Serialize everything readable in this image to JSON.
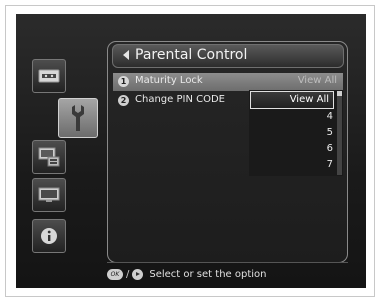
{
  "header": {
    "title": "Parental Control"
  },
  "menu": [
    {
      "number": "1",
      "label": "Maturity Lock",
      "value": "View All",
      "highlighted": true
    },
    {
      "number": "2",
      "label": "Change PIN CODE",
      "value": ""
    }
  ],
  "dropdown": {
    "selected": "View All",
    "options": [
      "View All",
      "4",
      "5",
      "6",
      "7"
    ]
  },
  "sidebar": {
    "icons": [
      "tv-signal-icon",
      "wrench-icon",
      "multi-screen-icon",
      "monitor-icon",
      "info-icon"
    ],
    "active": "wrench-icon"
  },
  "footer": {
    "ok_key": "OK",
    "separator": "/",
    "hint": "Select or set the option"
  },
  "colors": {
    "highlight": "#7d7d7d",
    "background": "#1e1e1e",
    "panel_border": "#8a8a8a"
  }
}
